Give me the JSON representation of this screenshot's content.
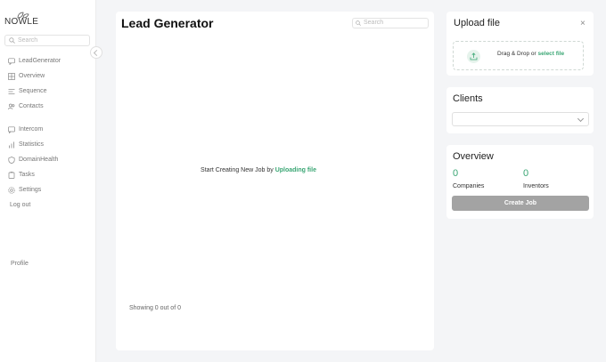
{
  "sidebar": {
    "logo_text": "NOWLE",
    "search_placeholder": "Search",
    "items": [
      {
        "label": "LeadGenerator",
        "icon": "chat-icon"
      },
      {
        "label": "Overview",
        "icon": "grid-icon"
      },
      {
        "label": "Sequence",
        "icon": "list-icon"
      },
      {
        "label": "Contacts",
        "icon": "users-icon"
      },
      {
        "label": "Intercom",
        "icon": "message-icon"
      },
      {
        "label": "Statistics",
        "icon": "bar-chart-icon"
      },
      {
        "label": "DomainHealth",
        "icon": "shield-icon"
      },
      {
        "label": "Tasks",
        "icon": "clipboard-icon"
      },
      {
        "label": "Settings",
        "icon": "gear-icon"
      }
    ],
    "logout": "Log out",
    "profile": "Profile"
  },
  "main": {
    "title": "Lead Generator",
    "search_placeholder": "Search",
    "empty_prefix": "Start Creating New Job by",
    "empty_link": "Uploading file",
    "showing": "Showing 0 out of 0"
  },
  "upload": {
    "title": "Upload file",
    "close": "×",
    "drag_text": "Drag & Drop or",
    "select_link": "select file"
  },
  "clients": {
    "title": "Clients",
    "selected": ""
  },
  "overview": {
    "title": "Overview",
    "companies_count": "0",
    "companies_label": "Companies",
    "inventors_count": "0",
    "inventors_label": "Inventors",
    "create_button": "Create Job"
  },
  "colors": {
    "accent": "#3aa674",
    "button_disabled": "#a3a3a3",
    "background": "#f4f5f7"
  }
}
